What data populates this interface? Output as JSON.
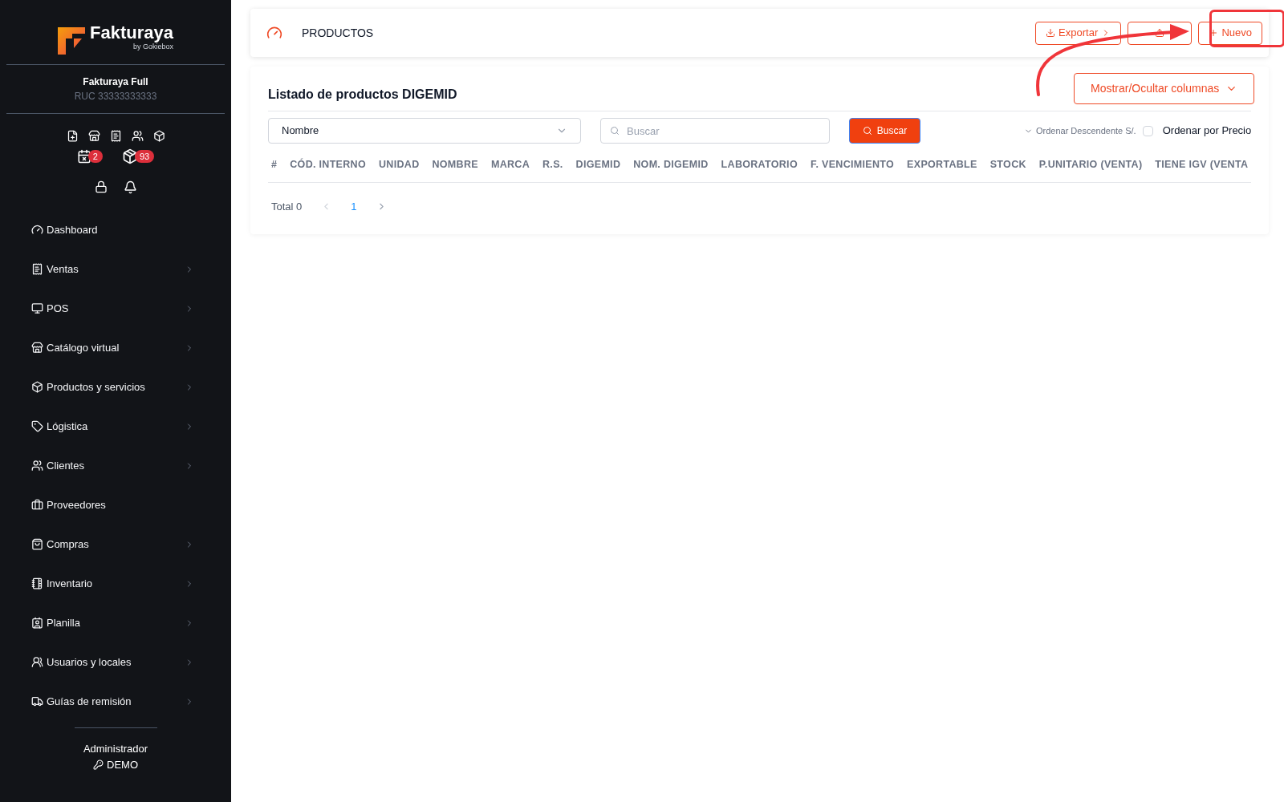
{
  "sidebar": {
    "logo": {
      "name": "Fakturaya",
      "byline": "by Gokiebox"
    },
    "company": "Fakturaya Full",
    "ruc": "RUC 33333333333",
    "badges": [
      "2",
      "93"
    ],
    "items": [
      {
        "label": "Dashboard",
        "expandable": false
      },
      {
        "label": "Ventas",
        "expandable": true
      },
      {
        "label": "POS",
        "expandable": true
      },
      {
        "label": "Catálogo virtual",
        "expandable": true
      },
      {
        "label": "Productos y servicios",
        "expandable": true
      },
      {
        "label": "Lógistica",
        "expandable": true
      },
      {
        "label": "Clientes",
        "expandable": true
      },
      {
        "label": "Proveedores",
        "expandable": false
      },
      {
        "label": "Compras",
        "expandable": true
      },
      {
        "label": "Inventario",
        "expandable": true
      },
      {
        "label": "Planilla",
        "expandable": true
      },
      {
        "label": "Usuarios y locales",
        "expandable": true
      },
      {
        "label": "Guías de remisión",
        "expandable": true
      }
    ],
    "user": {
      "role": "Administrador",
      "name": "DEMO"
    }
  },
  "header": {
    "title": "PRODUCTOS",
    "buttons": [
      {
        "kind": "export",
        "label": "Exportar"
      },
      {
        "kind": "import"
      },
      {
        "kind": "new",
        "label": "Nuevo"
      }
    ]
  },
  "list": {
    "title": "Listado de productos DIGEMID",
    "columns_button": "Mostrar/Ocultar columnas",
    "filter": {
      "value": "Nombre"
    },
    "search": {
      "placeholder": "Buscar"
    },
    "search_button": "Buscar",
    "sort": {
      "label": "Ordenar Descendente S/.",
      "disabled": true
    },
    "price_order": {
      "label": "Ordenar por Precio",
      "checked": false
    },
    "columns": [
      "#",
      "CÓD. INTERNO",
      "UNIDAD",
      "NOMBRE",
      "MARCA",
      "R.S.",
      "DIGEMID",
      "NOM. DIGEMID",
      "LABORATORIO",
      "F. VENCIMIENTO",
      "EXPORTABLE",
      "STOCK",
      "P.UNITARIO (VENTA)",
      "TIENE IGV (VENTA"
    ],
    "pagination": {
      "total": "Total 0",
      "pages": [
        {
          "label": "1",
          "selected": true
        }
      ]
    }
  }
}
